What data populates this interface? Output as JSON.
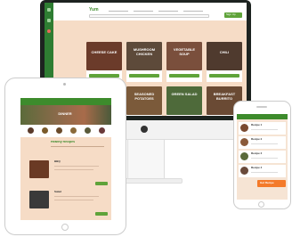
{
  "brand": {
    "green": "#3d8b2c",
    "light_green": "#5fa33a",
    "peach": "#f6dcc6",
    "dark": "#2f3a37"
  },
  "desktop": {
    "sidebar_icons": [
      "home-icon",
      "list-icon",
      "heart-icon"
    ],
    "logo": "Yum",
    "header_button": "Sign Up",
    "recipes": [
      {
        "title": "Cheese Cake",
        "color": "#6b3b2a"
      },
      {
        "title": "Mushroom Chicken",
        "color": "#5d4a3a"
      },
      {
        "title": "Vegetable Soup",
        "color": "#7a4f3c"
      },
      {
        "title": "Chili",
        "color": "#4f3a2e"
      },
      {
        "title": "Seasoned Potatoes",
        "color": "#7b5a3a"
      },
      {
        "title": "Green Salad",
        "color": "#4e6a3a"
      },
      {
        "title": "Breakfast Burrito",
        "color": "#6a4a34"
      }
    ]
  },
  "tablet": {
    "hero_title": "Dinner",
    "section_title": "Healthy Recipes",
    "items": [
      {
        "title": "BBQ",
        "color": "#6a3a24"
      },
      {
        "title": "Salad",
        "color": "#3a3a3a"
      }
    ]
  },
  "phone": {
    "items": [
      {
        "title": "Recipe 1",
        "color": "#7a4a30"
      },
      {
        "title": "Recipe 2",
        "color": "#8a5a3a"
      },
      {
        "title": "Recipe 3",
        "color": "#5a6a3a"
      },
      {
        "title": "Recipe 4",
        "color": "#6a4a3a"
      }
    ],
    "cta": "Get Recipe"
  }
}
